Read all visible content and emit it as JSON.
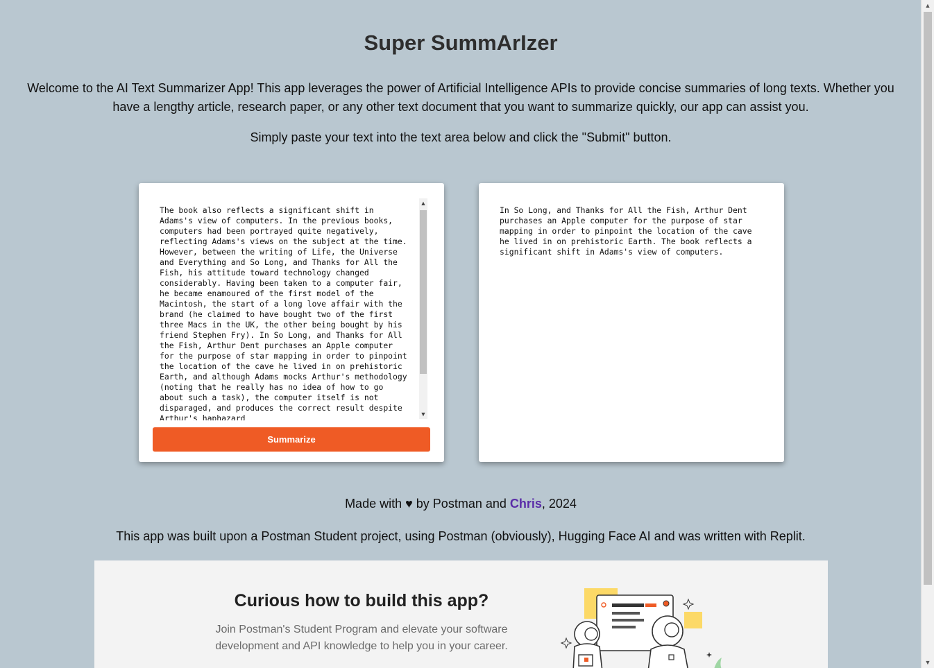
{
  "page": {
    "title": "Super SummArIzer",
    "intro": "Welcome to the AI Text Summarizer App! This app leverages the power of Artificial Intelligence APIs to provide concise summaries of long texts. Whether you have a lengthy article, research paper, or any other text document that you want to summarize quickly, our app can assist you.",
    "instruction": "Simply paste your text into the text area below and click the \"Submit\" button."
  },
  "input": {
    "text": "The book also reflects a significant shift in Adams's view of computers. In the previous books, computers had been portrayed quite negatively, reflecting Adams's views on the subject at the time. However, between the writing of Life, the Universe and Everything and So Long, and Thanks for All the Fish, his attitude toward technology changed considerably. Having been taken to a computer fair, he became enamoured of the first model of the Macintosh, the start of a long love affair with the brand (he claimed to have bought two of the first three Macs in the UK, the other being bought by his friend Stephen Fry). In So Long, and Thanks for All the Fish, Arthur Dent purchases an Apple computer for the purpose of star mapping in order to pinpoint the location of the cave he lived in on prehistoric Earth, and although Adams mocks Arthur's methodology (noting that he really has no idea of how to go about such a task), the computer itself is not disparaged, and produces the correct result despite Arthur's haphazard",
    "button_label": "Summarize"
  },
  "output": {
    "text": "In So Long, and Thanks for All the Fish, Arthur Dent purchases an Apple computer for the purpose of star mapping in order to pinpoint the location of the cave he lived in on prehistoric Earth. The book reflects a significant shift in Adams's view of computers."
  },
  "footer": {
    "made_prefix": "Made with ♥ by Postman and ",
    "made_link": "Chris",
    "made_suffix": ", 2024",
    "built": "This app was built upon a Postman Student project, using Postman (obviously), Hugging Face AI and was written with Replit."
  },
  "promo": {
    "heading": "Curious how to build this app?",
    "body": "Join Postman's Student Program and elevate your software development and API knowledge to help you in your career."
  },
  "colors": {
    "background": "#b9c7d0",
    "button": "#ef5b25",
    "link": "#5b2ea8"
  },
  "icons": {
    "scroll_up": "triangle-up-icon",
    "scroll_down": "triangle-down-icon",
    "heart": "heart-icon"
  }
}
